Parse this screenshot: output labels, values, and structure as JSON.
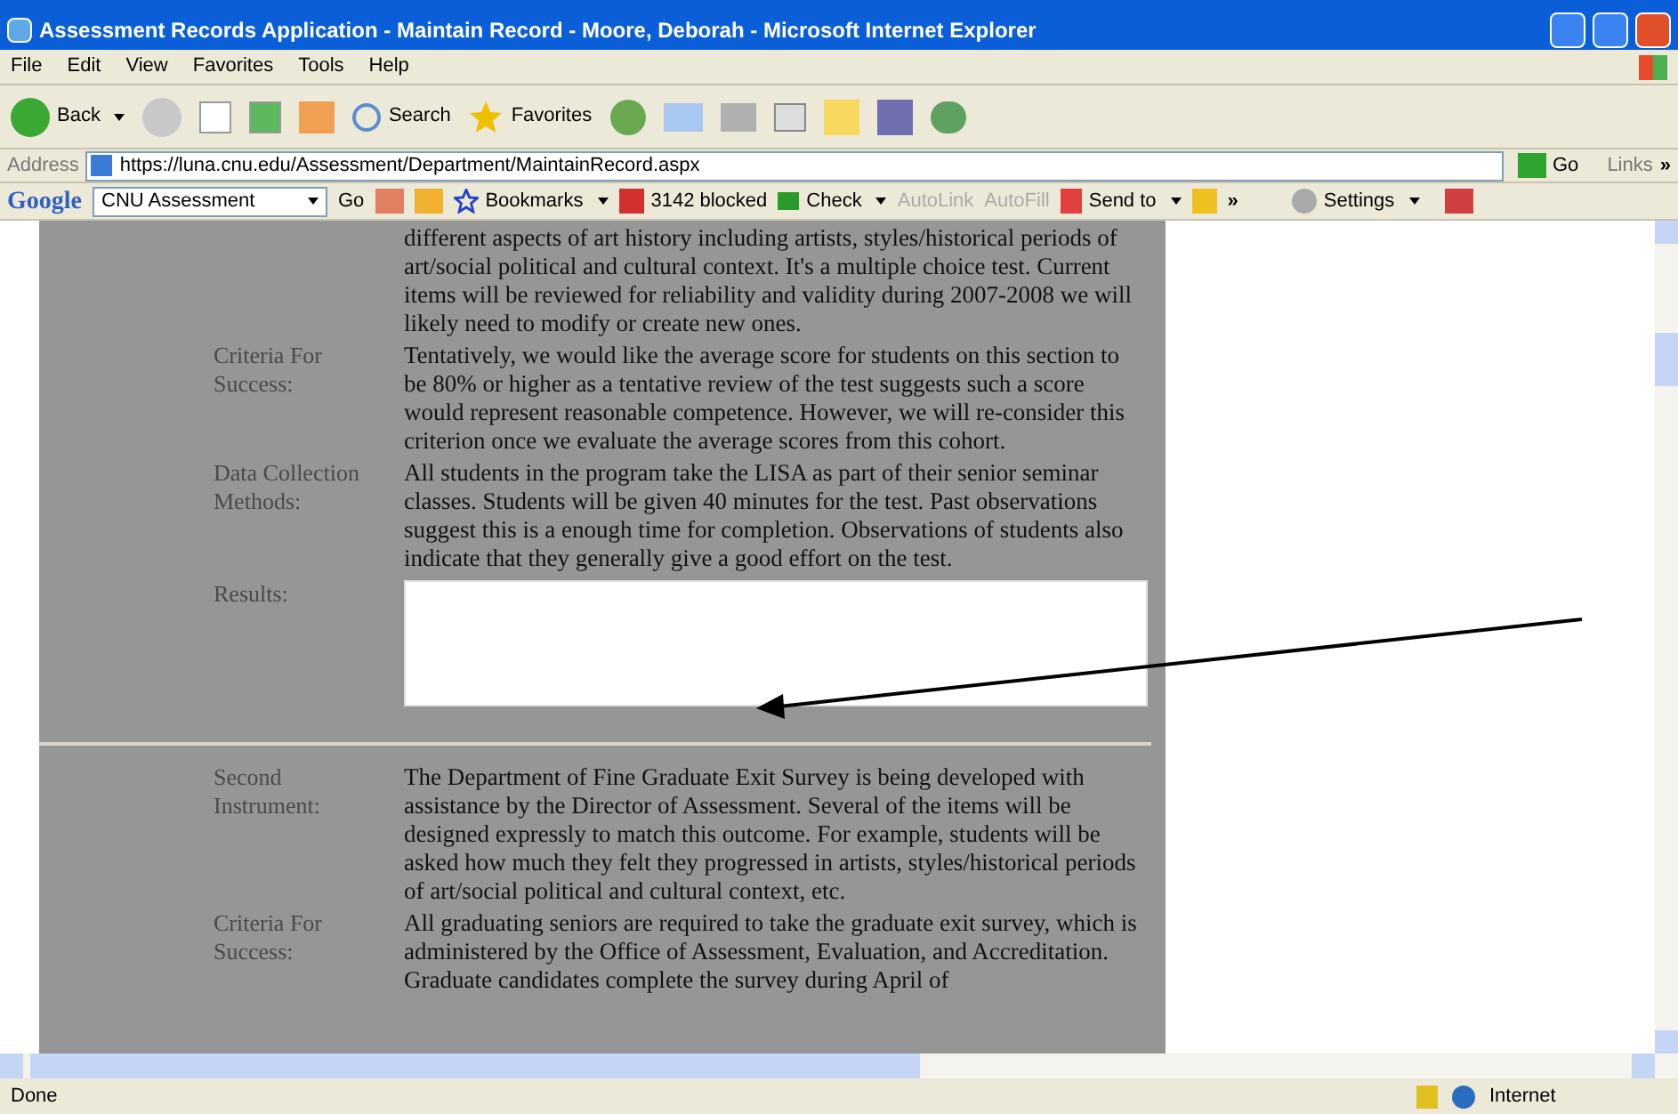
{
  "window": {
    "title": "Assessment Records Application - Maintain Record - Moore, Deborah - Microsoft Internet Explorer"
  },
  "menu": [
    "File",
    "Edit",
    "View",
    "Favorites",
    "Tools",
    "Help"
  ],
  "toolbar": {
    "back": "Back",
    "search": "Search",
    "favorites": "Favorites"
  },
  "address": {
    "label": "Address",
    "url": "https://luna.cnu.edu/Assessment/Department/MaintainRecord.aspx",
    "go": "Go",
    "links": "Links",
    "more": "»"
  },
  "google_bar": {
    "logo": "Google",
    "search_value": "CNU Assessment",
    "go": "Go",
    "bookmarks": "Bookmarks",
    "blocked": "3142 blocked",
    "check": "Check",
    "autolink": "AutoLink",
    "autofill": "AutoFill",
    "send_to": "Send to",
    "more": "»",
    "settings": "Settings"
  },
  "form": [
    {
      "kind": "text",
      "text": "different aspects of art history including artists, styles/historical periods of art/social political and cultural context. It's a multiple choice test. Current items will be reviewed for reliability and validity during 2007-2008 we will likely need to modify or create new ones."
    },
    {
      "kind": "text",
      "label": "Criteria For Success:",
      "text": "Tentatively, we would like the average score for students on this section to be 80% or higher as a tentative review of the test suggests such a score would represent reasonable competence. However, we will re-consider this criterion once we evaluate the average scores from this cohort."
    },
    {
      "kind": "text",
      "label": "Data Collection Methods:",
      "text": "All students in the program take the LISA as part of their senior seminar classes. Students will be given 40 minutes for the test. Past observations suggest this is a enough time for completion. Observations of students also indicate that they generally give a good effort on the test."
    },
    {
      "kind": "textarea",
      "label": "Results:"
    },
    {
      "kind": "divider"
    },
    {
      "kind": "text",
      "label": "Second Instrument:",
      "text": "The Department of Fine Graduate Exit Survey is being developed with assistance by the Director of Assessment. Several of the items will be designed expressly to match this outcome. For example, students will be asked how much they felt they progressed in artists, styles/historical periods of art/social political and cultural context, etc."
    },
    {
      "kind": "text",
      "label": "Criteria For Success:",
      "text": "All graduating seniors are required to take the graduate exit survey, which is administered by the Office of Assessment, Evaluation, and Accreditation. Graduate candidates complete the survey during April of"
    }
  ],
  "status_bar": {
    "text": "Done",
    "zone": "Internet"
  }
}
